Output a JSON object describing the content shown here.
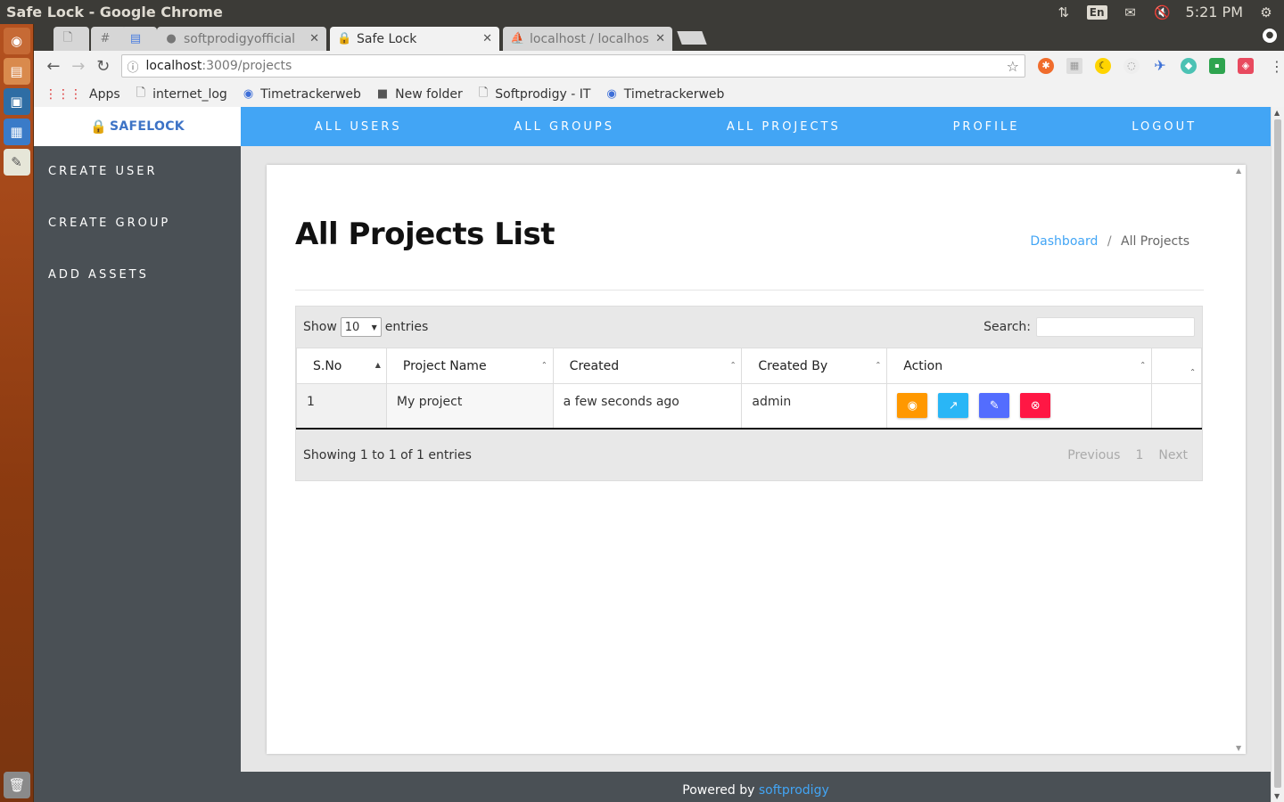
{
  "os": {
    "window_title": "Safe Lock - Google Chrome",
    "lang": "En",
    "clock": "5:21 PM"
  },
  "chrome": {
    "tabs": [
      {
        "label": "",
        "icon": "page-icon"
      },
      {
        "label": "",
        "icon": "hash-icon"
      },
      {
        "label": "",
        "icon": "docs-icon"
      },
      {
        "label": "softprodigyofficial",
        "icon": "github-icon"
      },
      {
        "label": "Safe Lock",
        "icon": "lock-icon"
      },
      {
        "label": "localhost / localhos",
        "icon": "pma-icon"
      }
    ],
    "url_host": "localhost",
    "url_path": ":3009/projects",
    "bookmarks": [
      {
        "label": "Apps",
        "icon": "apps-grid-icon"
      },
      {
        "label": "internet_log",
        "icon": "page-icon"
      },
      {
        "label": "Timetrackerweb",
        "icon": "timetracker-icon"
      },
      {
        "label": "New folder",
        "icon": "folder-icon"
      },
      {
        "label": "Softprodigy - IT",
        "icon": "page-icon"
      },
      {
        "label": "Timetrackerweb",
        "icon": "timetracker-icon"
      }
    ]
  },
  "app": {
    "brand": "SAFELOCK",
    "sidebar": [
      {
        "label": "CREATE USER"
      },
      {
        "label": "CREATE GROUP"
      },
      {
        "label": "ADD ASSETS"
      }
    ],
    "topnav": [
      {
        "label": "ALL USERS"
      },
      {
        "label": "ALL GROUPS"
      },
      {
        "label": "ALL PROJECTS"
      },
      {
        "label": "PROFILE"
      },
      {
        "label": "LOGOUT"
      }
    ],
    "page_title": "All Projects List",
    "breadcrumb": {
      "link": "Dashboard",
      "separator": "/",
      "current": "All Projects"
    },
    "table": {
      "show_label": "Show",
      "entries_label": "entries",
      "page_length": "10",
      "search_label": "Search:",
      "columns": [
        "S.No",
        "Project Name",
        "Created",
        "Created By",
        "Action",
        ""
      ],
      "rows": [
        {
          "sno": "1",
          "name": "My project",
          "created": "a few seconds ago",
          "created_by": "admin"
        }
      ],
      "info": "Showing 1 to 1 of 1 entries",
      "pager": {
        "previous": "Previous",
        "page": "1",
        "next": "Next"
      }
    },
    "footer": {
      "text": "Powered by",
      "link": "softprodigy"
    }
  },
  "colors": {
    "accent": "#42a5f5",
    "sidebar": "#4a5055",
    "view_btn": "#ff9800",
    "share_btn": "#29b6f6",
    "edit_btn": "#536dfe",
    "delete_btn": "#ff1744"
  }
}
